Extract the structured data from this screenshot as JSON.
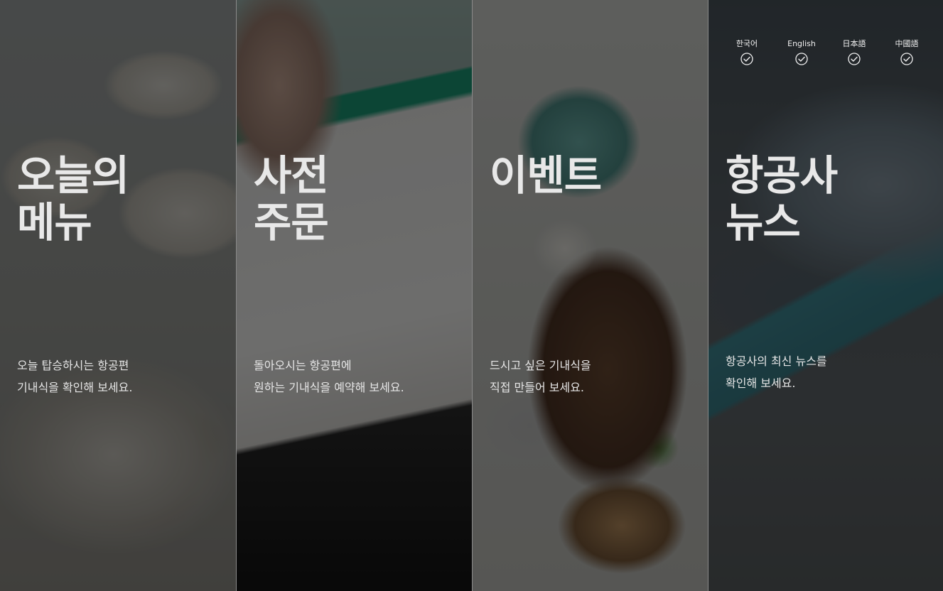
{
  "panels": [
    {
      "id": "todays-menu",
      "title_lines": [
        "오늘의",
        "메뉴"
      ],
      "desc_lines": [
        "오늘 탑승하시는 항공편",
        "기내식을 확인해 보세요."
      ]
    },
    {
      "id": "pre-order",
      "title_lines": [
        "사전",
        "주문"
      ],
      "desc_lines": [
        "돌아오시는 항공편에",
        "원하는 기내식을 예약해 보세요."
      ]
    },
    {
      "id": "event",
      "title_lines": [
        "이벤트"
      ],
      "desc_lines": [
        "드시고 싶은 기내식을",
        "직접 만들어 보세요."
      ]
    },
    {
      "id": "airline-news",
      "title_lines": [
        "항공사",
        "뉴스"
      ],
      "desc_lines": [
        "항공사의 최신 뉴스를",
        "확인해 보세요."
      ]
    }
  ],
  "languages": [
    {
      "label": "한국어",
      "icon": "check-circle-icon"
    },
    {
      "label": "English",
      "icon": "check-circle-icon"
    },
    {
      "label": "日本語",
      "icon": "check-circle-icon"
    },
    {
      "label": "中國語",
      "icon": "check-circle-icon"
    }
  ]
}
